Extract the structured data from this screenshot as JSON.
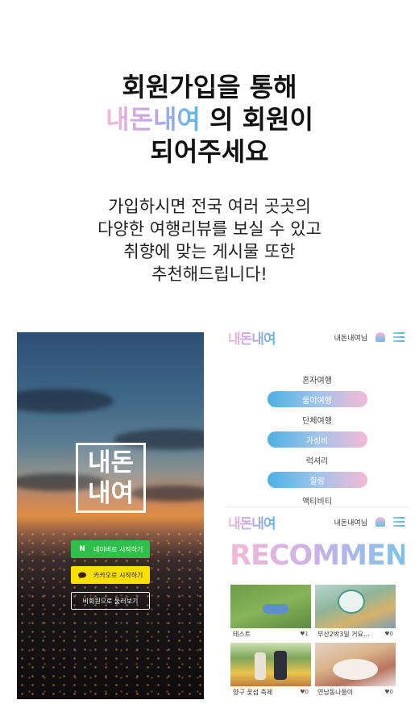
{
  "headline": {
    "line1": "회원가입을 통해",
    "brand": "내돈내여",
    "line2_suffix": "의 회원이",
    "line3": "되어주세요"
  },
  "subline": {
    "line1": "가입하시면 전국 여러 곳곳의",
    "line2": "다양한 여행리뷰를 보실 수 있고",
    "line3": "취향에 맞는 게시물 또한",
    "line4": "추천해드립니다!"
  },
  "login_screen": {
    "logo_top": "내돈",
    "logo_bottom": "내여",
    "naver_icon": "N",
    "naver_label": "네이버로 시작하기",
    "kakao_icon": "speech-bubble-icon",
    "kakao_label": "카카오로 시작하기",
    "guest_label": "비회원으로 둘러보기"
  },
  "menu_screen": {
    "brand": "내돈내여",
    "user": "내돈내여님",
    "items": [
      {
        "label": "혼자여행",
        "highlighted": false
      },
      {
        "label": "둘이여행",
        "highlighted": true
      },
      {
        "label": "단체여행",
        "highlighted": false
      },
      {
        "label": "가성비",
        "highlighted": true
      },
      {
        "label": "럭셔리",
        "highlighted": false
      },
      {
        "label": "힐링",
        "highlighted": true
      },
      {
        "label": "액티비티",
        "highlighted": false
      }
    ]
  },
  "recommend_screen": {
    "brand": "내돈내여",
    "user": "내돈내여님",
    "title": "RECOMMEND",
    "cards": [
      {
        "caption": "테스트",
        "likes": "♥1"
      },
      {
        "caption": "부산2박3일 거요...",
        "likes": "♥0"
      },
      {
        "caption": "양구 꽃섬 축제",
        "likes": "♥0"
      },
      {
        "caption": "연남동나들이",
        "likes": "♥0"
      }
    ]
  },
  "colors": {
    "brand_pink": "#f3b8d6",
    "brand_blue": "#5ab6e6",
    "naver_green": "#2ec04b",
    "kakao_yellow": "#f9e000"
  }
}
